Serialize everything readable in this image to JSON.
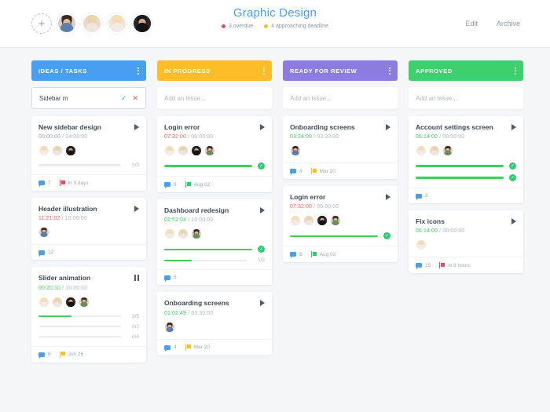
{
  "header": {
    "add_member_label": "+",
    "title": "Graphic Design",
    "overdue_text": "3 overdue",
    "overdue_color": "#f2485b",
    "approaching_text": "4 approaching deadline",
    "approaching_color": "#fbbd28",
    "edit_label": "Edit",
    "archive_label": "Archive",
    "members": [
      {
        "name": "member-avatar-1",
        "hair": "#3b2a21",
        "skin": "#e8b89a",
        "shirt": "#5b7fa8",
        "bg": "#d9cfc6"
      },
      {
        "name": "member-avatar-2",
        "hair": "#e8d9a8",
        "skin": "#f0cdb4",
        "shirt": "#efe7df",
        "bg": "#e6dcd2"
      },
      {
        "name": "member-avatar-3",
        "hair": "#f2e0b0",
        "skin": "#f6d7c2",
        "shirt": "#f3ece6",
        "bg": "#f0e6dc"
      },
      {
        "name": "member-avatar-4",
        "hair": "#1c1c1c",
        "skin": "#d9a882",
        "shirt": "#141414",
        "bg": "#2a2a2a"
      }
    ]
  },
  "columns": [
    {
      "id": "ideas-tasks",
      "title": "IDEAS / TASKS",
      "color": "#4a9ef0",
      "input": {
        "value": "Sidebar m",
        "placeholder": "Add an issue...",
        "editing": true,
        "check_label": "✓",
        "close_label": "✕"
      },
      "cards": [
        {
          "title": "New sidebar design",
          "control": "play",
          "elapsed": "00:00:00",
          "elapsed_state": "grey",
          "total": "24:00:00",
          "assignees": [
            {
              "hair": "#f2e0b0",
              "skin": "#f6d7c2",
              "shirt": "#f3ece6",
              "bg": "#f0e6dc"
            },
            {
              "hair": "#e8d9a8",
              "skin": "#f0cdb4",
              "shirt": "#efe7df",
              "bg": "#e6dcd2"
            },
            {
              "hair": "#1c1c1c",
              "skin": "#d9a882",
              "shirt": "#141414",
              "bg": "#2a2a2a"
            }
          ],
          "bars": [
            {
              "percent": 0,
              "label": "0/3",
              "done": false
            }
          ],
          "comments": "7",
          "due": "in 3 days",
          "due_flag": "#f2485b"
        },
        {
          "title": "Header illustration",
          "control": "play",
          "elapsed": "11:21:02",
          "elapsed_state": "red",
          "total": "10:00:00",
          "assignees": [
            {
              "hair": "#3b2a21",
              "skin": "#e8b89a",
              "shirt": "#5b7fa8",
              "bg": "#d9cfc6"
            }
          ],
          "bars": [],
          "comments": "12",
          "due": "",
          "due_flag": ""
        },
        {
          "title": "Slider animation",
          "control": "pause",
          "elapsed": "00:20:10",
          "elapsed_state": "green",
          "total": "10:00:00",
          "assignees": [
            {
              "hair": "#f2e0b0",
              "skin": "#f6d7c2",
              "shirt": "#f3ece6",
              "bg": "#f0e6dc"
            },
            {
              "hair": "#e8d9a8",
              "skin": "#f0cdb4",
              "shirt": "#efe7df",
              "bg": "#e6dcd2"
            },
            {
              "hair": "#1c1c1c",
              "skin": "#d9a882",
              "shirt": "#141414",
              "bg": "#2a2a2a"
            },
            {
              "hair": "#3b2a21",
              "skin": "#e8b89a",
              "shirt": "#6b8e5a",
              "bg": "#d9cfc6"
            }
          ],
          "bars": [
            {
              "percent": 40,
              "label": "2/5",
              "done": false
            },
            {
              "percent": 0,
              "label": "0/2",
              "done": false
            },
            {
              "percent": 0,
              "label": "0/4",
              "done": false
            }
          ],
          "comments": "6",
          "due": "Jun 26",
          "due_flag": "#fbbd28"
        }
      ]
    },
    {
      "id": "in-progress",
      "title": "IN PROGRESS",
      "color": "#fbbd28",
      "input": {
        "value": "",
        "placeholder": "Add an issue...",
        "editing": false
      },
      "cards": [
        {
          "title": "Login error",
          "control": "play",
          "elapsed": "07:32:00",
          "elapsed_state": "red",
          "total": "06:00:00",
          "assignees": [
            {
              "hair": "#f2e0b0",
              "skin": "#f6d7c2",
              "shirt": "#f3ece6",
              "bg": "#f0e6dc"
            },
            {
              "hair": "#e8d9a8",
              "skin": "#f0cdb4",
              "shirt": "#efe7df",
              "bg": "#e6dcd2"
            },
            {
              "hair": "#1c1c1c",
              "skin": "#d9a882",
              "shirt": "#141414",
              "bg": "#2a2a2a"
            },
            {
              "hair": "#3b2a21",
              "skin": "#e8b89a",
              "shirt": "#6b8e5a",
              "bg": "#d9cfc6"
            }
          ],
          "bars": [
            {
              "percent": 100,
              "label": "",
              "done": true
            }
          ],
          "comments": "8",
          "due": "Aug 02",
          "due_flag": "#2ecc71"
        },
        {
          "title": "Dashboard redesign",
          "control": "play",
          "elapsed": "02:52:04",
          "elapsed_state": "green",
          "total": "10:00:00",
          "assignees": [
            {
              "hair": "#f2e0b0",
              "skin": "#f6d7c2",
              "shirt": "#f3ece6",
              "bg": "#f0e6dc"
            },
            {
              "hair": "#e8d9a8",
              "skin": "#f0cdb4",
              "shirt": "#efe7df",
              "bg": "#e6dcd2"
            },
            {
              "hair": "#3b2a21",
              "skin": "#e8b89a",
              "shirt": "#6b8e5a",
              "bg": "#d9cfc6"
            }
          ],
          "bars": [
            {
              "percent": 100,
              "label": "",
              "done": true
            },
            {
              "percent": 33,
              "label": "1/3",
              "done": false
            }
          ],
          "comments": "6",
          "due": "",
          "due_flag": ""
        },
        {
          "title": "Onboarding screens",
          "control": "play",
          "elapsed": "01:02:49",
          "elapsed_state": "green",
          "total": "03:30:00",
          "assignees": [
            {
              "hair": "#3b2a21",
              "skin": "#e8b89a",
              "shirt": "#5b7fa8",
              "bg": "#d9cfc6"
            }
          ],
          "bars": [],
          "comments": "4",
          "due": "Mar 20",
          "due_flag": "#fbbd28"
        }
      ]
    },
    {
      "id": "ready-for-review",
      "title": "READY FOR REVIEW",
      "color": "#8b7cdd",
      "input": {
        "value": "",
        "placeholder": "Add an issue...",
        "editing": false
      },
      "cards": [
        {
          "title": "Onboarding screens",
          "control": "play",
          "elapsed": "03:24:00",
          "elapsed_state": "green",
          "total": "03:30:00",
          "assignees": [
            {
              "hair": "#3b2a21",
              "skin": "#e8b89a",
              "shirt": "#5b7fa8",
              "bg": "#d9cfc6"
            }
          ],
          "bars": [],
          "comments": "4",
          "due": "Mar 20",
          "due_flag": "#fbbd28"
        },
        {
          "title": "Login error",
          "control": "play",
          "elapsed": "07:32:00",
          "elapsed_state": "red",
          "total": "06:00:00",
          "assignees": [
            {
              "hair": "#f2e0b0",
              "skin": "#f6d7c2",
              "shirt": "#f3ece6",
              "bg": "#f0e6dc"
            },
            {
              "hair": "#e8d9a8",
              "skin": "#f0cdb4",
              "shirt": "#efe7df",
              "bg": "#e6dcd2"
            },
            {
              "hair": "#1c1c1c",
              "skin": "#d9a882",
              "shirt": "#141414",
              "bg": "#2a2a2a"
            },
            {
              "hair": "#3b2a21",
              "skin": "#e8b89a",
              "shirt": "#6b8e5a",
              "bg": "#d9cfc6"
            }
          ],
          "bars": [
            {
              "percent": 100,
              "label": "",
              "done": true
            }
          ],
          "comments": "8",
          "due": "Aug 02",
          "due_flag": "#2ecc71"
        }
      ]
    },
    {
      "id": "approved",
      "title": "APPROVED",
      "color": "#3ecf6f",
      "input": {
        "value": "",
        "placeholder": "Add an issue...",
        "editing": false
      },
      "cards": [
        {
          "title": "Account settings screen",
          "control": "play",
          "elapsed": "06:14:00",
          "elapsed_state": "green",
          "total": "08:00:00",
          "assignees": [
            {
              "hair": "#f2e0b0",
              "skin": "#f6d7c2",
              "shirt": "#f3ece6",
              "bg": "#f0e6dc"
            },
            {
              "hair": "#e8d9a8",
              "skin": "#f0cdb4",
              "shirt": "#efe7df",
              "bg": "#e6dcd2"
            },
            {
              "hair": "#3b2a21",
              "skin": "#e8b89a",
              "shirt": "#6b8e5a",
              "bg": "#d9cfc6"
            }
          ],
          "bars": [
            {
              "percent": 100,
              "label": "",
              "done": true
            },
            {
              "percent": 100,
              "label": "",
              "done": true
            }
          ],
          "comments": "6",
          "due": "",
          "due_flag": ""
        },
        {
          "title": "Fix icons",
          "control": "play",
          "elapsed": "06:14:00",
          "elapsed_state": "green",
          "total": "08:00:00",
          "assignees": [
            {
              "hair": "#f2e0b0",
              "skin": "#f6d7c2",
              "shirt": "#f3ece6",
              "bg": "#f0e6dc"
            }
          ],
          "bars": [],
          "comments": "15",
          "due": "in 8 hours",
          "due_flag": "#f2485b"
        }
      ]
    }
  ]
}
